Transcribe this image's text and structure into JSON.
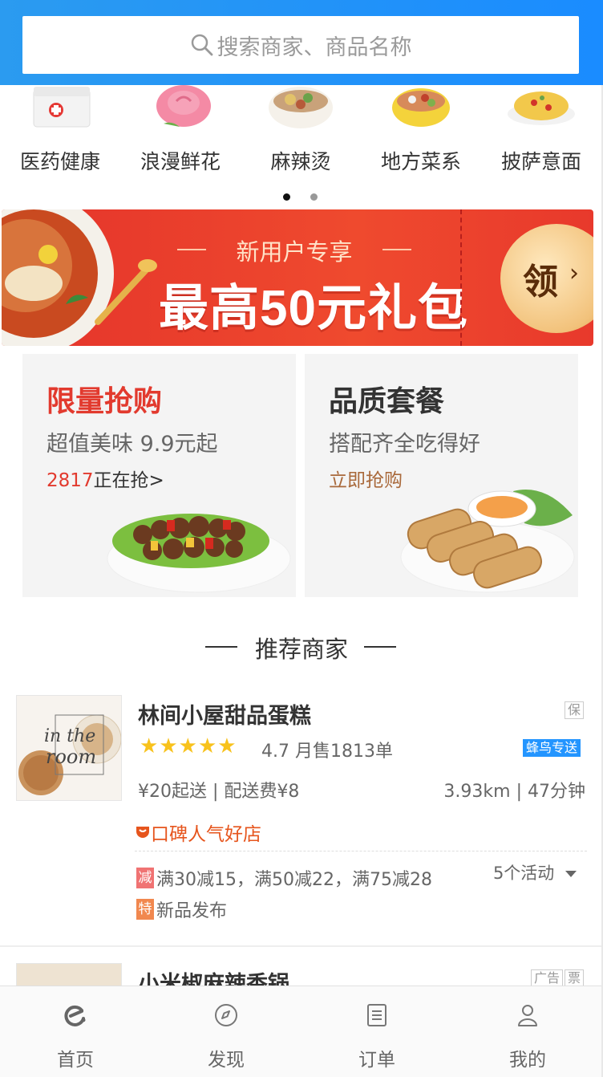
{
  "search": {
    "placeholder": "搜索商家、商品名称"
  },
  "categories": [
    {
      "label": "医药健康",
      "icon": "medical-kit-icon"
    },
    {
      "label": "浪漫鲜花",
      "icon": "rose-icon"
    },
    {
      "label": "麻辣烫",
      "icon": "spicy-hotpot-bowl-icon"
    },
    {
      "label": "地方菜系",
      "icon": "regional-dish-icon"
    },
    {
      "label": "披萨意面",
      "icon": "pasta-icon"
    }
  ],
  "carousel": {
    "pages": 2,
    "active_page": 1,
    "active_color": "#111111",
    "inactive_color": "#999999"
  },
  "banner": {
    "subtitle": "新用户专享",
    "title": "最高50元礼包",
    "claim_label": "领",
    "claim_arrow": "›"
  },
  "promos": [
    {
      "title": "限量抢购",
      "title_color": "#e23a2e",
      "desc": "超值美味 9.9元起",
      "count": "2817",
      "link": "正在抢>",
      "count_color": "#e23a2e"
    },
    {
      "title": "品质套餐",
      "title_color": "#333333",
      "desc": "搭配齐全吃得好",
      "link": "立即抢购",
      "link_color": "#a9693b"
    }
  ],
  "section_title": "推荐商家",
  "shops": [
    {
      "name": "林间小屋甜品蛋糕",
      "tag_bao": "保",
      "rating": "4.7",
      "rating_value": 4.7,
      "monthly_sales": "月售1813单",
      "delivery_badge": "蜂鸟专送",
      "min_order": "¥20起送",
      "sep": "|",
      "delivery_fee": "配送费¥8",
      "distance": "3.93km",
      "time": "47分钟",
      "badge": "口碑人气好店",
      "activities": [
        {
          "tag": "减",
          "tag_color": "#f07373",
          "text": "满30减15，满50减22，满75减28"
        },
        {
          "tag": "特",
          "tag_color": "#f1884f",
          "text": "新品发布"
        }
      ],
      "activities_count": "5个活动",
      "thumb_text_1": "in the",
      "thumb_text_2": "room"
    },
    {
      "name": "小米椒麻辣香锅",
      "tag_ad": "广告",
      "tag_piao": "票"
    }
  ],
  "tabs": [
    {
      "label": "首页",
      "icon": "home-e-icon"
    },
    {
      "label": "发现",
      "icon": "compass-icon"
    },
    {
      "label": "订单",
      "icon": "order-list-icon"
    },
    {
      "label": "我的",
      "icon": "profile-icon"
    }
  ],
  "colors": {
    "header_blue": "#1a8cff",
    "accent_red": "#e23a2e",
    "star": "#f8c21c",
    "fengniao_blue": "#2395ff"
  }
}
